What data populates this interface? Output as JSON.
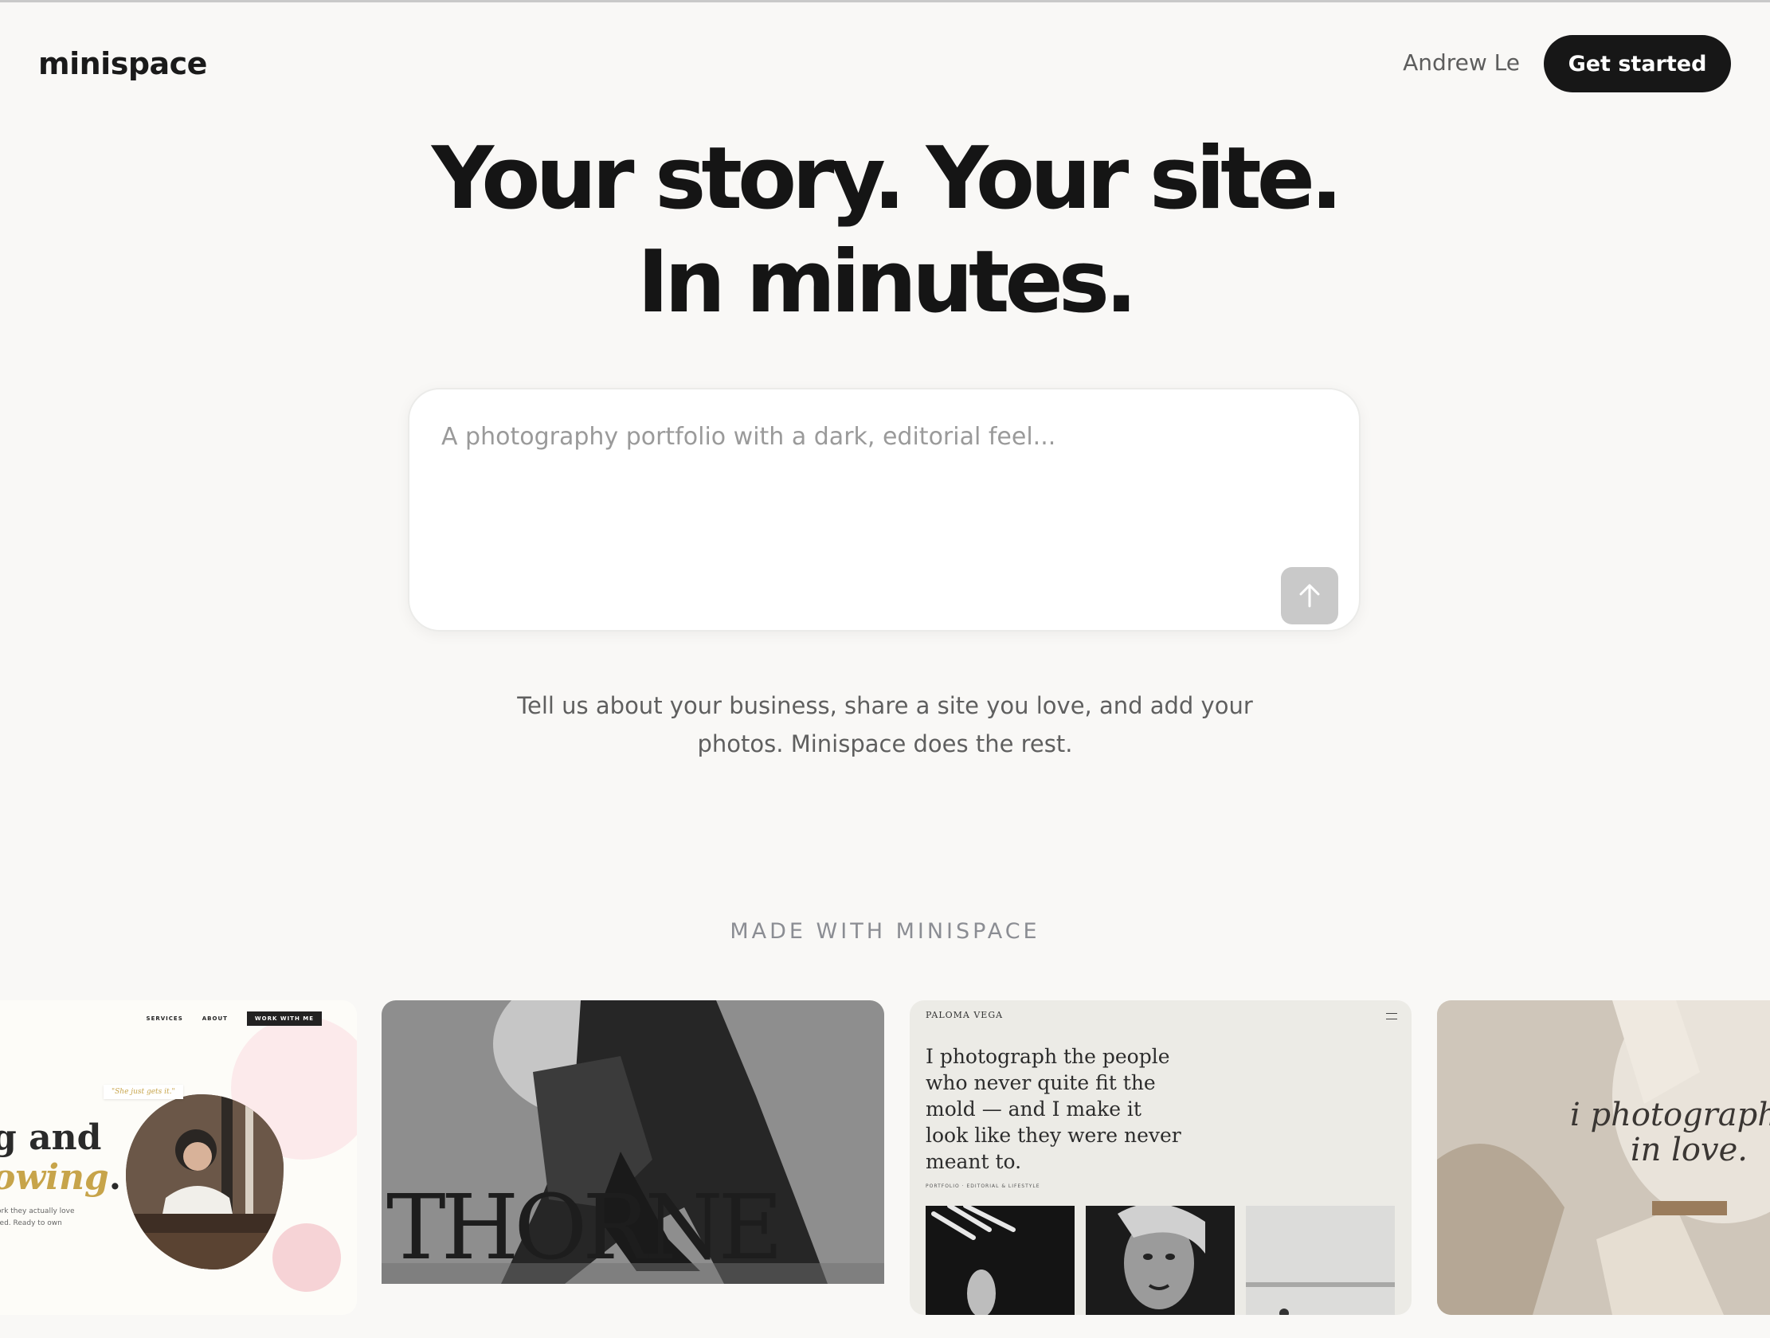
{
  "header": {
    "logo": "minispace",
    "user_name": "Andrew Le",
    "cta_label": "Get started"
  },
  "hero": {
    "line1": "Your story. Your site.",
    "line2": "In minutes."
  },
  "prompt": {
    "placeholder": "A photography portfolio with a dark, editorial feel..."
  },
  "subcopy": {
    "line1": "Tell us about your business, share a site you love, and add your",
    "line2": "photos. Minispace does the rest."
  },
  "showcase": {
    "heading": "MADE WITH MINISPACE",
    "card1": {
      "nav": [
        "SERVICES",
        "ABOUT"
      ],
      "nav_button": "WORK WITH ME",
      "quote": "\"She just gets it.\"",
      "headline_line1": "g and",
      "headline_line2": "owing",
      "headline_punct": ".",
      "small_text": "ork they actually love ted. Ready to own"
    },
    "card2": {
      "wordmark": "THORNE"
    },
    "card3": {
      "name": "PALOMA VEGA",
      "text": "I photograph the people who never quite fit the mold — and I make it look like they were never meant to.",
      "meta": "PORTFOLIO · EDITORIAL & LIFESTYLE"
    },
    "card4": {
      "text_line1": "i photograph pe",
      "text_line2": "in love."
    }
  },
  "colors": {
    "background": "#f9f8f6",
    "cta_bg": "#171717",
    "accent_gold": "#c7a44a"
  },
  "icons": {
    "send": "arrow-up-icon"
  }
}
